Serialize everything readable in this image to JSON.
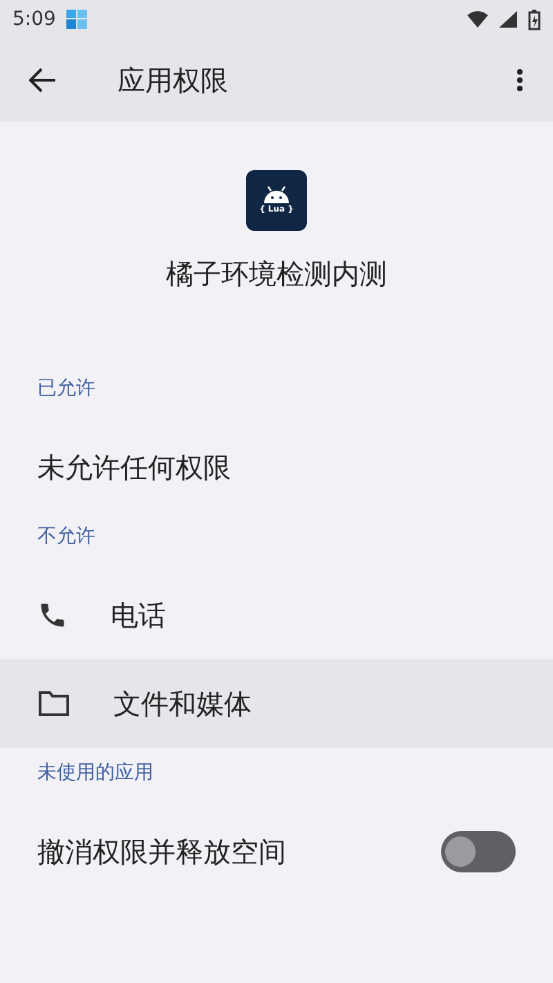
{
  "status_bar": {
    "time": "5:09"
  },
  "app_bar": {
    "title": "应用权限"
  },
  "app": {
    "icon_label": "{ Lua }",
    "name": "橘子环境检测内测"
  },
  "sections": [
    {
      "header": "已允许",
      "items": [
        {
          "kind": "text",
          "label": "未允许任何权限",
          "highlighted": false
        }
      ]
    },
    {
      "header": "不允许",
      "items": [
        {
          "kind": "phone",
          "label": "电话",
          "highlighted": false
        },
        {
          "kind": "folder",
          "label": "文件和媒体",
          "highlighted": true
        }
      ]
    },
    {
      "header": "未使用的应用",
      "items": [
        {
          "kind": "switch",
          "label": "撤消权限并释放空间",
          "on": false,
          "highlighted": false
        }
      ]
    }
  ]
}
